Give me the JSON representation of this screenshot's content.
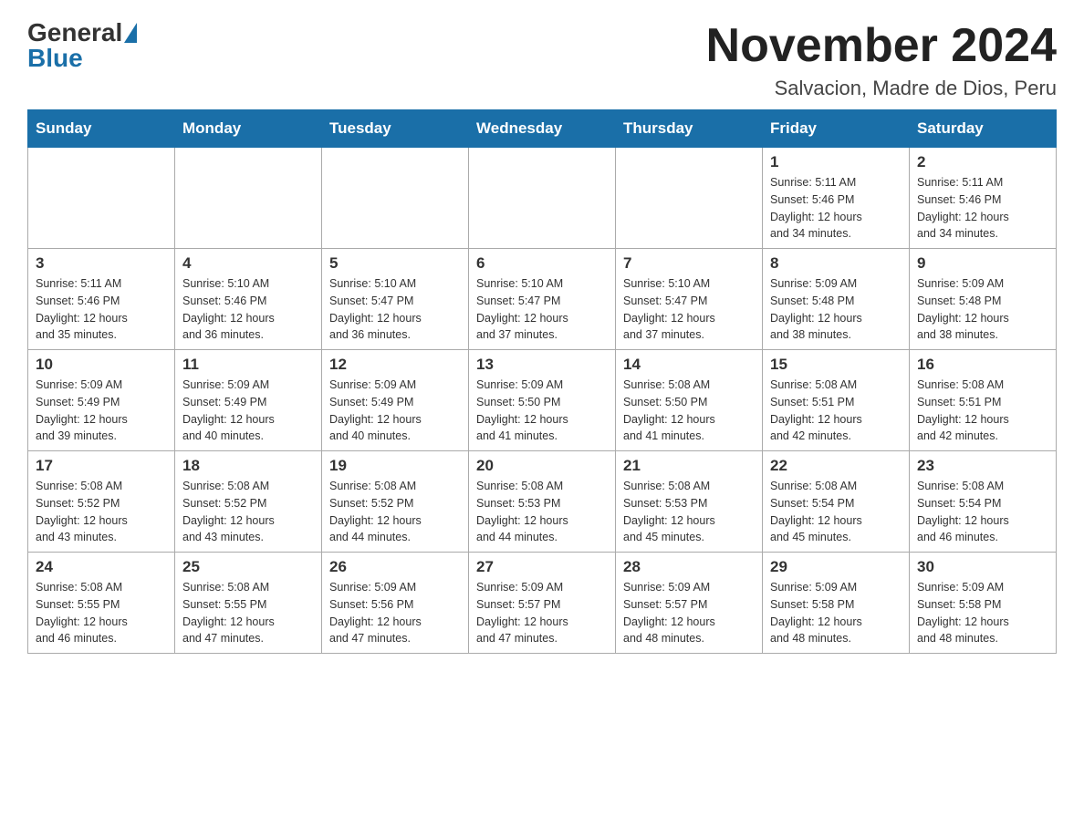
{
  "header": {
    "logo": {
      "text_general": "General",
      "text_blue": "Blue"
    },
    "title": "November 2024",
    "location": "Salvacion, Madre de Dios, Peru"
  },
  "days_of_week": [
    "Sunday",
    "Monday",
    "Tuesday",
    "Wednesday",
    "Thursday",
    "Friday",
    "Saturday"
  ],
  "weeks": [
    [
      {
        "day": "",
        "info": ""
      },
      {
        "day": "",
        "info": ""
      },
      {
        "day": "",
        "info": ""
      },
      {
        "day": "",
        "info": ""
      },
      {
        "day": "",
        "info": ""
      },
      {
        "day": "1",
        "info": "Sunrise: 5:11 AM\nSunset: 5:46 PM\nDaylight: 12 hours\nand 34 minutes."
      },
      {
        "day": "2",
        "info": "Sunrise: 5:11 AM\nSunset: 5:46 PM\nDaylight: 12 hours\nand 34 minutes."
      }
    ],
    [
      {
        "day": "3",
        "info": "Sunrise: 5:11 AM\nSunset: 5:46 PM\nDaylight: 12 hours\nand 35 minutes."
      },
      {
        "day": "4",
        "info": "Sunrise: 5:10 AM\nSunset: 5:46 PM\nDaylight: 12 hours\nand 36 minutes."
      },
      {
        "day": "5",
        "info": "Sunrise: 5:10 AM\nSunset: 5:47 PM\nDaylight: 12 hours\nand 36 minutes."
      },
      {
        "day": "6",
        "info": "Sunrise: 5:10 AM\nSunset: 5:47 PM\nDaylight: 12 hours\nand 37 minutes."
      },
      {
        "day": "7",
        "info": "Sunrise: 5:10 AM\nSunset: 5:47 PM\nDaylight: 12 hours\nand 37 minutes."
      },
      {
        "day": "8",
        "info": "Sunrise: 5:09 AM\nSunset: 5:48 PM\nDaylight: 12 hours\nand 38 minutes."
      },
      {
        "day": "9",
        "info": "Sunrise: 5:09 AM\nSunset: 5:48 PM\nDaylight: 12 hours\nand 38 minutes."
      }
    ],
    [
      {
        "day": "10",
        "info": "Sunrise: 5:09 AM\nSunset: 5:49 PM\nDaylight: 12 hours\nand 39 minutes."
      },
      {
        "day": "11",
        "info": "Sunrise: 5:09 AM\nSunset: 5:49 PM\nDaylight: 12 hours\nand 40 minutes."
      },
      {
        "day": "12",
        "info": "Sunrise: 5:09 AM\nSunset: 5:49 PM\nDaylight: 12 hours\nand 40 minutes."
      },
      {
        "day": "13",
        "info": "Sunrise: 5:09 AM\nSunset: 5:50 PM\nDaylight: 12 hours\nand 41 minutes."
      },
      {
        "day": "14",
        "info": "Sunrise: 5:08 AM\nSunset: 5:50 PM\nDaylight: 12 hours\nand 41 minutes."
      },
      {
        "day": "15",
        "info": "Sunrise: 5:08 AM\nSunset: 5:51 PM\nDaylight: 12 hours\nand 42 minutes."
      },
      {
        "day": "16",
        "info": "Sunrise: 5:08 AM\nSunset: 5:51 PM\nDaylight: 12 hours\nand 42 minutes."
      }
    ],
    [
      {
        "day": "17",
        "info": "Sunrise: 5:08 AM\nSunset: 5:52 PM\nDaylight: 12 hours\nand 43 minutes."
      },
      {
        "day": "18",
        "info": "Sunrise: 5:08 AM\nSunset: 5:52 PM\nDaylight: 12 hours\nand 43 minutes."
      },
      {
        "day": "19",
        "info": "Sunrise: 5:08 AM\nSunset: 5:52 PM\nDaylight: 12 hours\nand 44 minutes."
      },
      {
        "day": "20",
        "info": "Sunrise: 5:08 AM\nSunset: 5:53 PM\nDaylight: 12 hours\nand 44 minutes."
      },
      {
        "day": "21",
        "info": "Sunrise: 5:08 AM\nSunset: 5:53 PM\nDaylight: 12 hours\nand 45 minutes."
      },
      {
        "day": "22",
        "info": "Sunrise: 5:08 AM\nSunset: 5:54 PM\nDaylight: 12 hours\nand 45 minutes."
      },
      {
        "day": "23",
        "info": "Sunrise: 5:08 AM\nSunset: 5:54 PM\nDaylight: 12 hours\nand 46 minutes."
      }
    ],
    [
      {
        "day": "24",
        "info": "Sunrise: 5:08 AM\nSunset: 5:55 PM\nDaylight: 12 hours\nand 46 minutes."
      },
      {
        "day": "25",
        "info": "Sunrise: 5:08 AM\nSunset: 5:55 PM\nDaylight: 12 hours\nand 47 minutes."
      },
      {
        "day": "26",
        "info": "Sunrise: 5:09 AM\nSunset: 5:56 PM\nDaylight: 12 hours\nand 47 minutes."
      },
      {
        "day": "27",
        "info": "Sunrise: 5:09 AM\nSunset: 5:57 PM\nDaylight: 12 hours\nand 47 minutes."
      },
      {
        "day": "28",
        "info": "Sunrise: 5:09 AM\nSunset: 5:57 PM\nDaylight: 12 hours\nand 48 minutes."
      },
      {
        "day": "29",
        "info": "Sunrise: 5:09 AM\nSunset: 5:58 PM\nDaylight: 12 hours\nand 48 minutes."
      },
      {
        "day": "30",
        "info": "Sunrise: 5:09 AM\nSunset: 5:58 PM\nDaylight: 12 hours\nand 48 minutes."
      }
    ]
  ]
}
